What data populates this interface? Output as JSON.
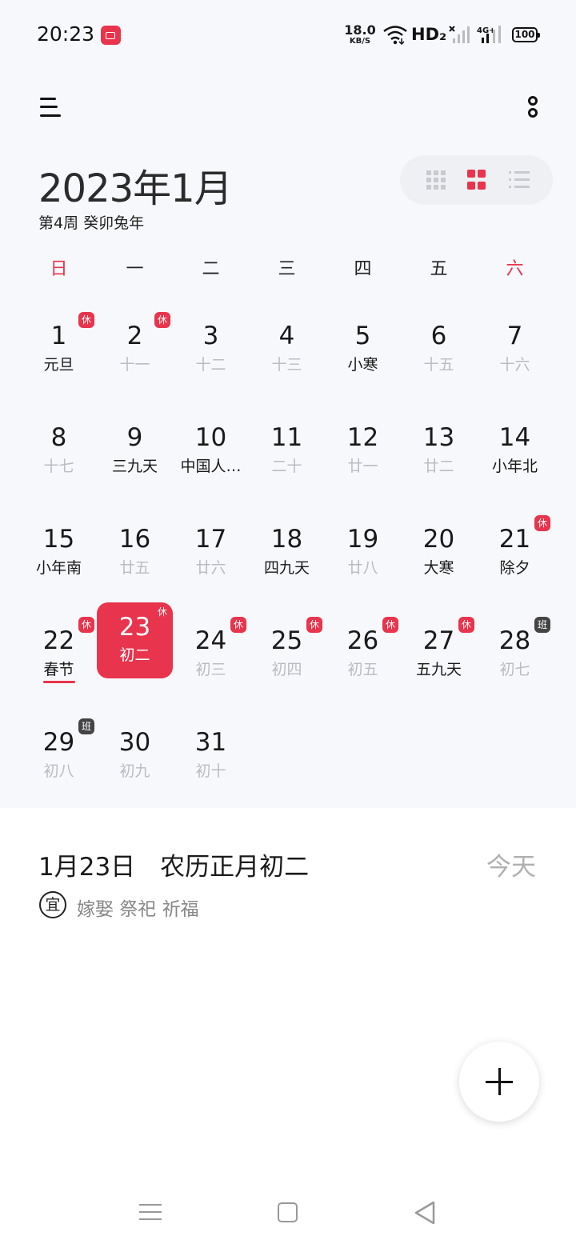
{
  "status_bar": {
    "time": "20:23",
    "net_speed_value": "18.0",
    "net_speed_unit": "KB/S",
    "hd": "HD₂",
    "battery": "100"
  },
  "header": {
    "title": "2023年1月",
    "week_info": "第4周 癸卯兔年"
  },
  "weekdays": [
    "日",
    "一",
    "二",
    "三",
    "四",
    "五",
    "六"
  ],
  "days": [
    {
      "num": "1",
      "lunar": "元旦",
      "badge": "休"
    },
    {
      "num": "2",
      "lunar": "十一",
      "badge": "休"
    },
    {
      "num": "3",
      "lunar": "十二"
    },
    {
      "num": "4",
      "lunar": "十三"
    },
    {
      "num": "5",
      "lunar": "小寒"
    },
    {
      "num": "6",
      "lunar": "十五"
    },
    {
      "num": "7",
      "lunar": "十六"
    },
    {
      "num": "8",
      "lunar": "十七"
    },
    {
      "num": "9",
      "lunar": "三九天"
    },
    {
      "num": "10",
      "lunar": "中国人…"
    },
    {
      "num": "11",
      "lunar": "二十"
    },
    {
      "num": "12",
      "lunar": "廿一"
    },
    {
      "num": "13",
      "lunar": "廿二"
    },
    {
      "num": "14",
      "lunar": "小年北"
    },
    {
      "num": "15",
      "lunar": "小年南"
    },
    {
      "num": "16",
      "lunar": "廿五"
    },
    {
      "num": "17",
      "lunar": "廿六"
    },
    {
      "num": "18",
      "lunar": "四九天"
    },
    {
      "num": "19",
      "lunar": "廿八"
    },
    {
      "num": "20",
      "lunar": "大寒"
    },
    {
      "num": "21",
      "lunar": "除夕",
      "badge": "休"
    },
    {
      "num": "22",
      "lunar": "春节",
      "badge": "休"
    },
    {
      "num": "23",
      "lunar": "初二",
      "badge": "休"
    },
    {
      "num": "24",
      "lunar": "初三",
      "badge": "休"
    },
    {
      "num": "25",
      "lunar": "初四",
      "badge": "休"
    },
    {
      "num": "26",
      "lunar": "初五",
      "badge": "休"
    },
    {
      "num": "27",
      "lunar": "五九天",
      "badge": "休"
    },
    {
      "num": "28",
      "lunar": "初七",
      "badge": "班"
    },
    {
      "num": "29",
      "lunar": "初八",
      "badge": "班"
    },
    {
      "num": "30",
      "lunar": "初九"
    },
    {
      "num": "31",
      "lunar": "初十"
    }
  ],
  "selected_day": "23",
  "detail": {
    "date_title": "1月23日　农历正月初二",
    "today_label": "今天",
    "yi_label": "宜",
    "yi_items": "嫁娶 祭祀 祈福"
  },
  "colors": {
    "accent": "#e8344c",
    "work_badge": "#444444",
    "lunar_muted": "#b9bcc2"
  }
}
